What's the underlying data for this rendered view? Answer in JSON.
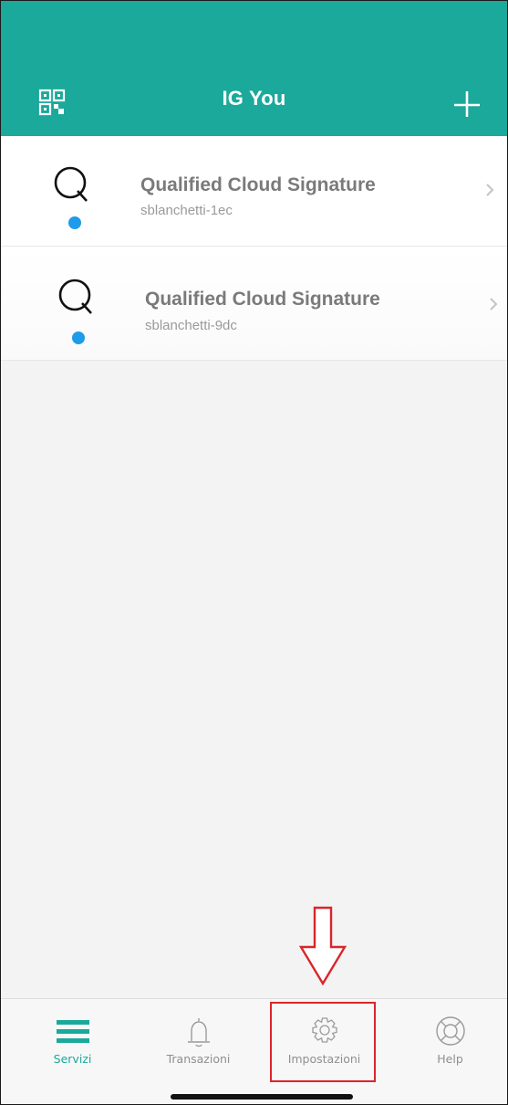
{
  "header": {
    "title": "IG You",
    "background": "#1aa99b",
    "left_icon": "qr-code-icon",
    "right_icon": "plus-icon"
  },
  "services": [
    {
      "name": "Qualified Cloud Signature",
      "account": "sblanchetti-1ec",
      "icon": "q-logo-icon",
      "status_dot_color": "#1e9be9"
    },
    {
      "name": "Qualified Cloud Signature",
      "account": "sblanchetti-9dc",
      "icon": "q-logo-icon",
      "status_dot_color": "#1e9be9"
    }
  ],
  "annotation": {
    "arrow_icon": "down-arrow-icon",
    "highlight_color": "#d9262b",
    "highlighted_tab": "Impostazioni"
  },
  "tabbar": {
    "tabs": [
      {
        "label": "Servizi",
        "icon": "menu-icon",
        "active": true
      },
      {
        "label": "Transazioni",
        "icon": "bell-icon",
        "active": false
      },
      {
        "label": "Impostazioni",
        "icon": "gear-icon",
        "active": false
      },
      {
        "label": "Help",
        "icon": "lifebuoy-icon",
        "active": false
      }
    ],
    "accent_color": "#1aa99b"
  }
}
